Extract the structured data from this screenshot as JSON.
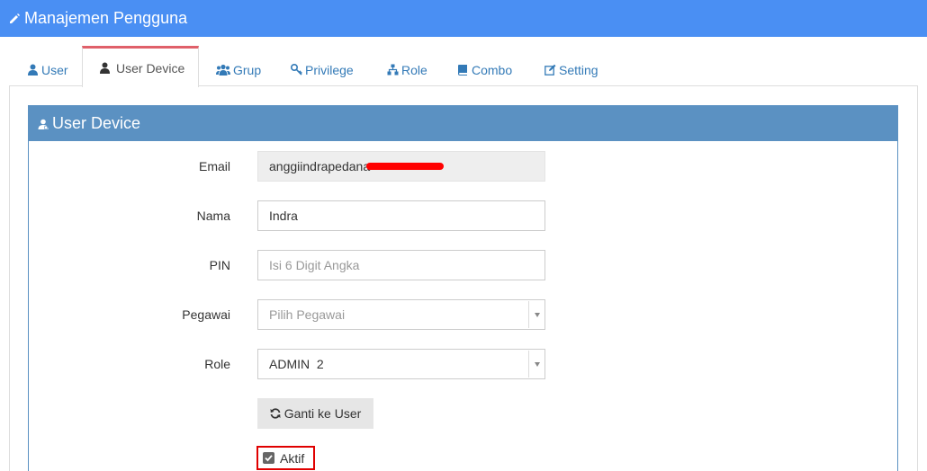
{
  "header": {
    "title": "Manajemen Pengguna",
    "icon": "pencil-icon"
  },
  "tabs": [
    {
      "label": "User",
      "icon": "user-icon"
    },
    {
      "label": "User Device",
      "icon": "user-icon",
      "active": true
    },
    {
      "label": "Grup",
      "icon": "users-icon"
    },
    {
      "label": "Privilege",
      "icon": "key-icon"
    },
    {
      "label": "Role",
      "icon": "sitemap-icon"
    },
    {
      "label": "Combo",
      "icon": "book-icon"
    },
    {
      "label": "Setting",
      "icon": "edit-icon"
    }
  ],
  "panel": {
    "title": "User Device",
    "icon": "user-secret-icon"
  },
  "form": {
    "email": {
      "label": "Email",
      "value": "anggiindrapedana"
    },
    "nama": {
      "label": "Nama",
      "value": "Indra"
    },
    "pin": {
      "label": "PIN",
      "placeholder": "Isi 6 Digit Angka"
    },
    "pegawai": {
      "label": "Pegawai",
      "placeholder": "Pilih Pegawai"
    },
    "role": {
      "label": "Role",
      "value": "ADMIN  2"
    },
    "switch_button": {
      "label": "Ganti ke User",
      "icon": "refresh-icon"
    },
    "aktif": {
      "label": "Aktif",
      "checked": true
    }
  },
  "colors": {
    "header": "#4a8ff3",
    "panel_header": "#5b91c2",
    "active_tab_border": "#e0606a",
    "link": "#337ab7",
    "highlight": "#e00000"
  }
}
